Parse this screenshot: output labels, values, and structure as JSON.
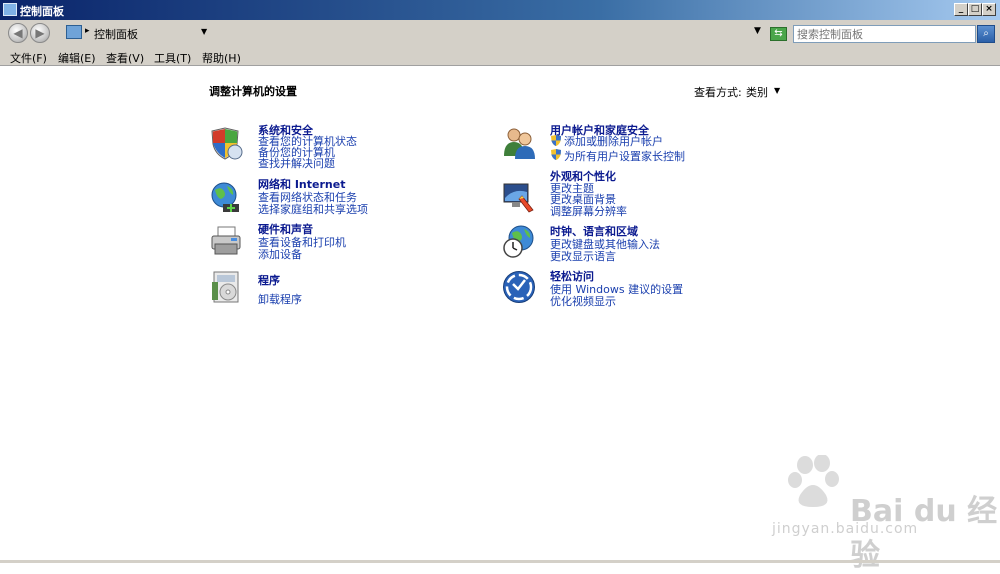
{
  "window": {
    "title": "控制面板"
  },
  "address": {
    "path": "控制面板",
    "search_placeholder": "搜索控制面板"
  },
  "menu": {
    "file": "文件(F)",
    "edit": "编辑(E)",
    "view": "查看(V)",
    "tools": "工具(T)",
    "help": "帮助(H)"
  },
  "main": {
    "title": "调整计算机的设置",
    "view_by_label": "查看方式:",
    "view_by_value": "类别"
  },
  "categories": [
    {
      "title": "系统和安全",
      "links": [
        "查看您的计算机状态",
        "备份您的计算机",
        "查找并解决问题"
      ]
    },
    {
      "title": "网络和 Internet",
      "links": [
        "查看网络状态和任务",
        "选择家庭组和共享选项"
      ]
    },
    {
      "title": "硬件和声音",
      "links": [
        "查看设备和打印机",
        "添加设备"
      ]
    },
    {
      "title": "程序",
      "links": [
        "卸载程序"
      ]
    },
    {
      "title": "用户帐户和家庭安全",
      "links": [
        "添加或删除用户帐户",
        "为所有用户设置家长控制"
      ]
    },
    {
      "title": "外观和个性化",
      "links": [
        "更改主题",
        "更改桌面背景",
        "调整屏幕分辨率"
      ]
    },
    {
      "title": "时钟、语言和区域",
      "links": [
        "更改键盘或其他输入法",
        "更改显示语言"
      ]
    },
    {
      "title": "轻松访问",
      "links": [
        "使用 Windows 建议的设置",
        "优化视频显示"
      ]
    }
  ],
  "watermark": {
    "brand": "Bai du 经验",
    "url": "jingyan.baidu.com"
  },
  "icons": {
    "system_security": "shield-icon",
    "network": "globe-network-icon",
    "hardware": "printer-icon",
    "programs": "programs-icon",
    "user_accounts": "users-icon",
    "appearance": "display-icon",
    "clock": "clock-globe-icon",
    "ease_of_access": "ease-of-access-icon"
  },
  "colors": {
    "link": "#1a3fae",
    "category_title": "#0b1a8f",
    "titlebar": "#0a246a"
  }
}
